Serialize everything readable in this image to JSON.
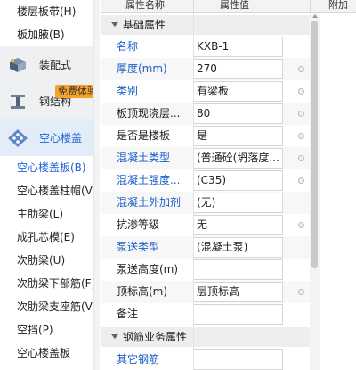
{
  "left_panel": {
    "top_items": [
      "楼层板带(H)",
      "板加腋(B)"
    ],
    "categories": [
      {
        "label": "装配式",
        "icon": "prefab-icon"
      },
      {
        "label": "钢结构",
        "icon": "steel-beam-icon",
        "badge": "免费体验"
      },
      {
        "label": "空心楼盖",
        "icon": "hollow-floor-icon"
      }
    ],
    "sub_items": [
      "空心楼盖板(B)",
      "空心楼盖柱帽(V)",
      "主肋梁(L)",
      "成孔芯模(E)",
      "次肋梁(U)",
      "次肋梁下部筋(F)",
      "次肋梁支座筋(V)",
      "空挡(P)",
      "空心楼盖板"
    ]
  },
  "grid": {
    "headers": [
      "属性名称",
      "属性值",
      "附加"
    ],
    "group1": "基础属性",
    "rows": [
      {
        "name": "名称",
        "value": "KXB-1",
        "link": true,
        "dot": false
      },
      {
        "name": "厚度(mm)",
        "value": "270",
        "link": true,
        "dot": true
      },
      {
        "name": "类别",
        "value": "有梁板",
        "link": true,
        "dot": true
      },
      {
        "name": "板顶现浇层...",
        "value": "80",
        "link": false,
        "dot": true
      },
      {
        "name": "是否是楼板",
        "value": "是",
        "link": false,
        "dot": true
      },
      {
        "name": "混凝土类型",
        "value": "(普通砼(坍落度...",
        "link": true,
        "dot": true
      },
      {
        "name": "混凝土强度...",
        "value": "(C35)",
        "link": true,
        "dot": true
      },
      {
        "name": "混凝土外加剂",
        "value": "(无)",
        "link": true,
        "dot": false
      },
      {
        "name": "抗渗等级",
        "value": "无",
        "link": false,
        "dot": true
      },
      {
        "name": "泵送类型",
        "value": "(混凝土泵)",
        "link": true,
        "dot": false
      },
      {
        "name": "泵送高度(m)",
        "value": "",
        "link": false,
        "dot": false
      },
      {
        "name": "顶标高(m)",
        "value": "层顶标高",
        "link": false,
        "dot": true
      },
      {
        "name": "备注",
        "value": "",
        "link": false,
        "dot": false
      }
    ],
    "group2": "钢筋业务属性",
    "last_row": {
      "name": "其它钢筋",
      "value": ""
    }
  },
  "colors": {
    "accent": "#1f63d4",
    "link": "#1a5fc8",
    "badge": "#f7a32b"
  }
}
